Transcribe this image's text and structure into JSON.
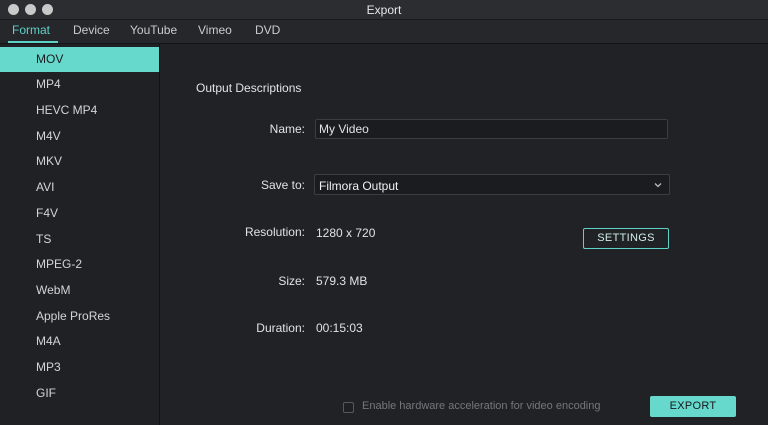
{
  "window": {
    "title": "Export"
  },
  "tabs": [
    "Format",
    "Device",
    "YouTube",
    "Vimeo",
    "DVD"
  ],
  "active_tab": "Format",
  "formats": [
    "MOV",
    "MP4",
    "HEVC MP4",
    "M4V",
    "MKV",
    "AVI",
    "F4V",
    "TS",
    "MPEG-2",
    "WebM",
    "Apple ProRes",
    "M4A",
    "MP3",
    "GIF"
  ],
  "selected_format": "MOV",
  "output": {
    "section_title": "Output Descriptions",
    "name_label": "Name:",
    "name_value": "My Video",
    "save_label": "Save to:",
    "save_value": "Filmora Output",
    "resolution_label": "Resolution:",
    "resolution_value": "1280 x 720",
    "settings_button": "SETTINGS",
    "size_label": "Size:",
    "size_value": "579.3 MB",
    "duration_label": "Duration:",
    "duration_value": "00:15:03"
  },
  "footer": {
    "hw_accel_label": "Enable hardware acceleration for video encoding",
    "hw_accel_checked": false,
    "export_button": "EXPORT"
  },
  "colors": {
    "accent": "#67d8cc",
    "background": "#202226",
    "sidebar": "#1f2125"
  }
}
